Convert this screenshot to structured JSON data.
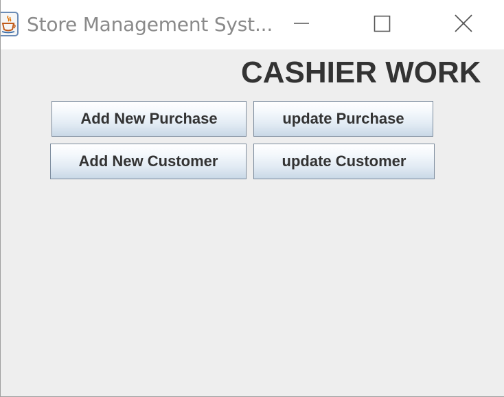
{
  "window": {
    "title": "Store Management Syst...",
    "app_icon": "java-icon",
    "controls": {
      "minimize_icon": "minimize-icon",
      "maximize_icon": "maximize-icon",
      "close_icon": "close-icon"
    }
  },
  "main": {
    "heading": "CASHIER WORK",
    "buttons": {
      "add_purchase": "Add New Purchase",
      "update_purchase": "update Purchase",
      "add_customer": "Add New Customer",
      "update_customer": "update Customer"
    }
  },
  "colors": {
    "window_background": "#eeeeee",
    "titlebar_background": "#ffffff",
    "title_text": "#8a8a8a",
    "heading_text": "#333333",
    "button_border": "#7a8a9c"
  }
}
